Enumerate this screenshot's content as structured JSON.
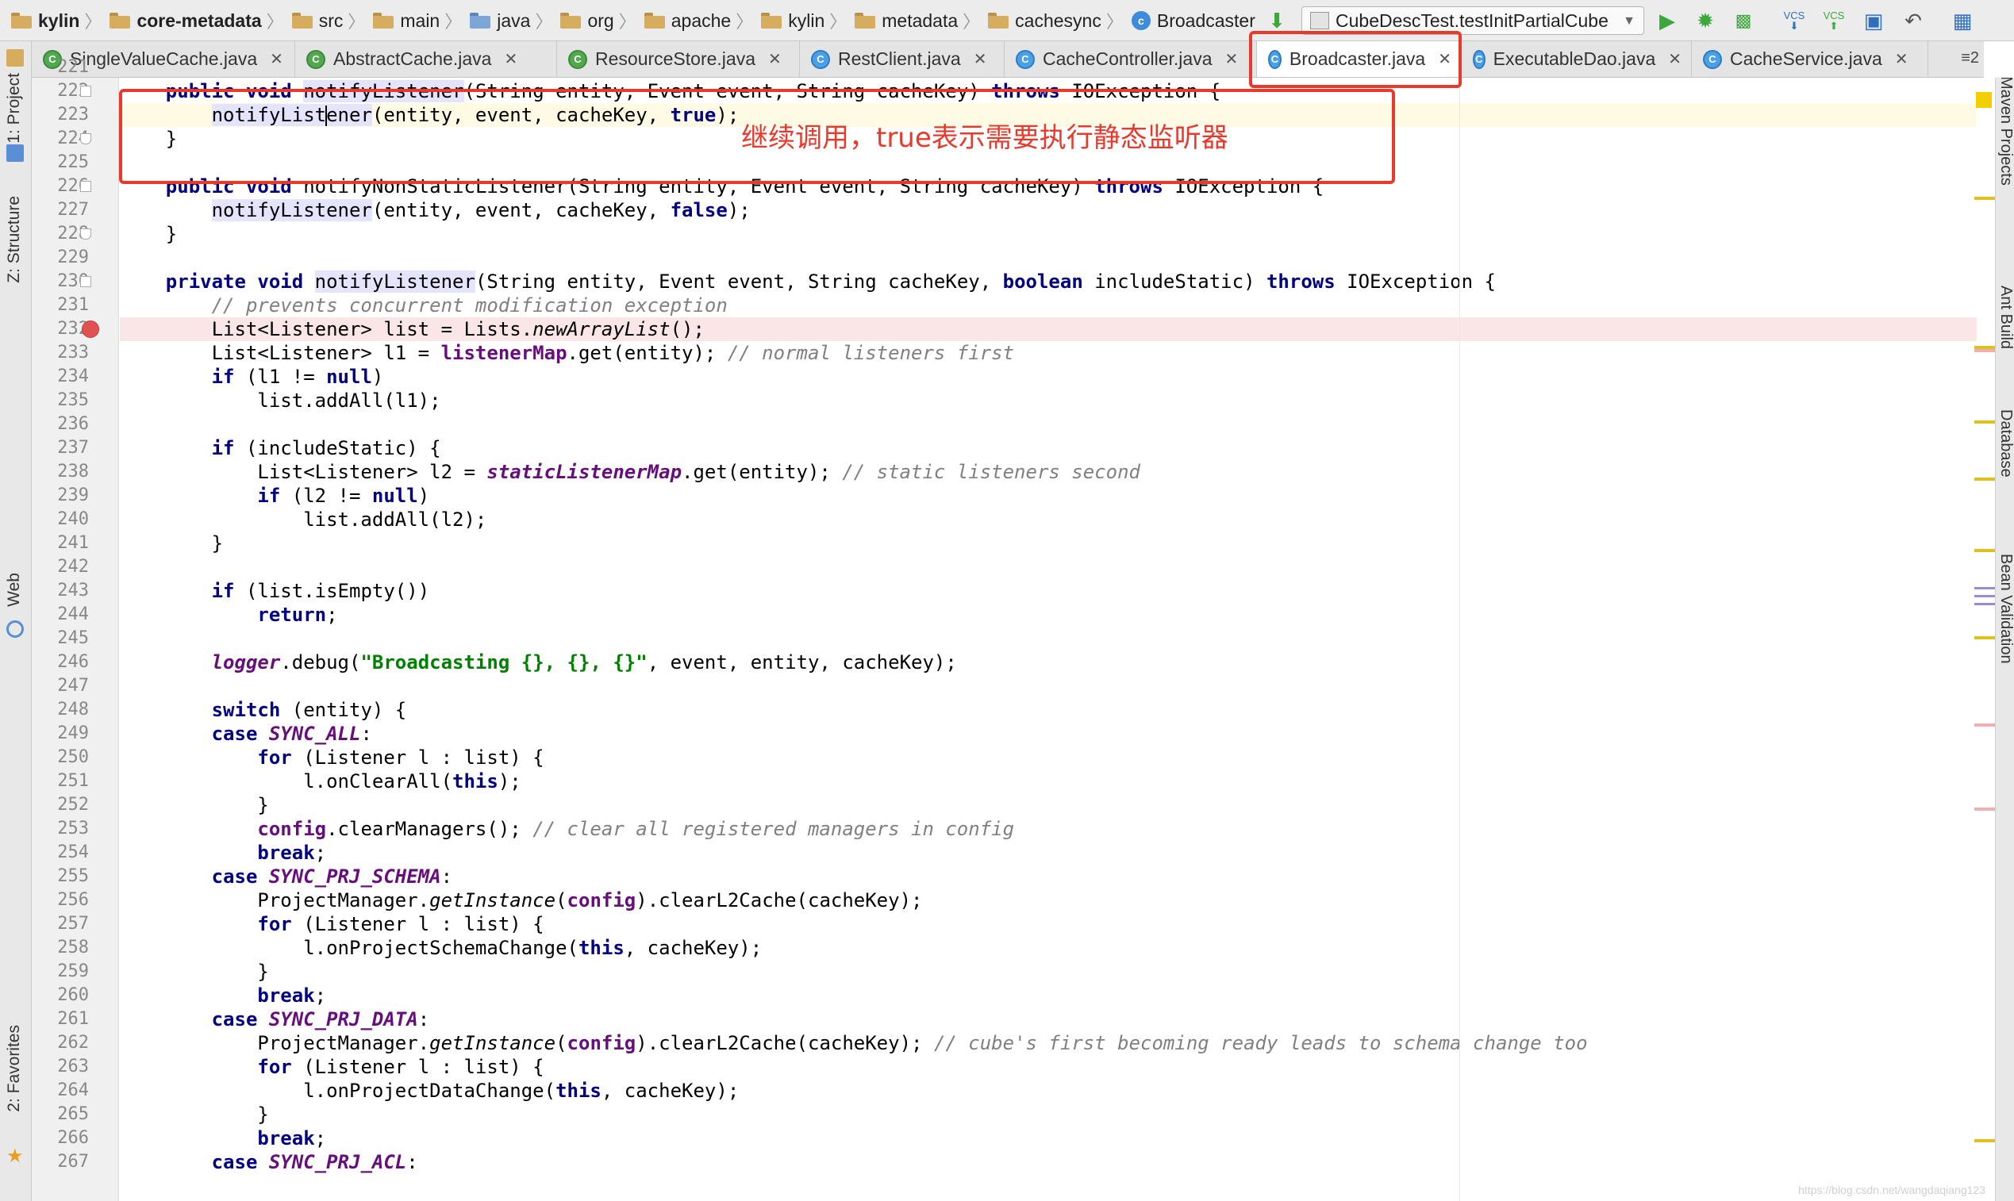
{
  "breadcrumbs": [
    {
      "label": "kylin",
      "kind": "root"
    },
    {
      "label": "core-metadata",
      "kind": "module"
    },
    {
      "label": "src",
      "kind": "folder"
    },
    {
      "label": "main",
      "kind": "folder"
    },
    {
      "label": "java",
      "kind": "src"
    },
    {
      "label": "org",
      "kind": "folder"
    },
    {
      "label": "apache",
      "kind": "folder"
    },
    {
      "label": "kylin",
      "kind": "folder"
    },
    {
      "label": "metadata",
      "kind": "folder"
    },
    {
      "label": "cachesync",
      "kind": "folder"
    },
    {
      "label": "Broadcaster",
      "kind": "class"
    }
  ],
  "run_config": "CubeDescTest.testInitPartialCube",
  "toolbar": {
    "vcs1": "VCS",
    "vcs2": "VCS",
    "colors": {
      "run": "#3aa83a",
      "debug": "#3aa83a"
    }
  },
  "tabs": [
    {
      "label": "SingleValueCache.java",
      "icon": "C",
      "green": true,
      "active": false
    },
    {
      "label": "AbstractCache.java",
      "icon": "C",
      "green": true,
      "active": false
    },
    {
      "label": "ResourceStore.java",
      "icon": "C",
      "green": true,
      "active": false
    },
    {
      "label": "RestClient.java",
      "icon": "C",
      "green": false,
      "active": false
    },
    {
      "label": "CacheController.java",
      "icon": "C",
      "green": false,
      "active": false
    },
    {
      "label": "Broadcaster.java",
      "icon": "C",
      "green": false,
      "active": true
    },
    {
      "label": "ExecutableDao.java",
      "icon": "C",
      "green": false,
      "active": false
    },
    {
      "label": "CacheService.java",
      "icon": "C",
      "green": false,
      "active": false
    }
  ],
  "tabs_overflow": "≡2",
  "left_tools": {
    "project": "1: Project",
    "structure": "Z: Structure",
    "web": "Web",
    "favorites": "2: Favorites"
  },
  "right_tools": {
    "maven": "Maven Projects",
    "ant": "Ant Build",
    "database": "Database",
    "bean": "Bean Validation"
  },
  "code_lines": [
    {
      "n": "221",
      "t": ""
    },
    {
      "n": "222",
      "t": "    public void notifyListener(String entity, Event event, String cacheKey) throws IOException {"
    },
    {
      "n": "223",
      "t": "        notifyListener(entity, event, cacheKey, true);"
    },
    {
      "n": "224",
      "t": "    }"
    },
    {
      "n": "225",
      "t": ""
    },
    {
      "n": "226",
      "t": "    public void notifyNonStaticListener(String entity, Event event, String cacheKey) throws IOException {"
    },
    {
      "n": "227",
      "t": "        notifyListener(entity, event, cacheKey, false);"
    },
    {
      "n": "228",
      "t": "    }"
    },
    {
      "n": "229",
      "t": ""
    },
    {
      "n": "230",
      "t": "    private void notifyListener(String entity, Event event, String cacheKey, boolean includeStatic) throws IOException {"
    },
    {
      "n": "231",
      "t": "        // prevents concurrent modification exception"
    },
    {
      "n": "232",
      "t": "        List<Listener> list = Lists.newArrayList();"
    },
    {
      "n": "233",
      "t": "        List<Listener> l1 = listenerMap.get(entity); // normal listeners first"
    },
    {
      "n": "234",
      "t": "        if (l1 != null)"
    },
    {
      "n": "235",
      "t": "            list.addAll(l1);"
    },
    {
      "n": "236",
      "t": ""
    },
    {
      "n": "237",
      "t": "        if (includeStatic) {"
    },
    {
      "n": "238",
      "t": "            List<Listener> l2 = staticListenerMap.get(entity); // static listeners second"
    },
    {
      "n": "239",
      "t": "            if (l2 != null)"
    },
    {
      "n": "240",
      "t": "                list.addAll(l2);"
    },
    {
      "n": "241",
      "t": "        }"
    },
    {
      "n": "242",
      "t": ""
    },
    {
      "n": "243",
      "t": "        if (list.isEmpty())"
    },
    {
      "n": "244",
      "t": "            return;"
    },
    {
      "n": "245",
      "t": ""
    },
    {
      "n": "246",
      "t": "        logger.debug(\"Broadcasting {}, {}, {}\", event, entity, cacheKey);"
    },
    {
      "n": "247",
      "t": ""
    },
    {
      "n": "248",
      "t": "        switch (entity) {"
    },
    {
      "n": "249",
      "t": "        case SYNC_ALL:"
    },
    {
      "n": "250",
      "t": "            for (Listener l : list) {"
    },
    {
      "n": "251",
      "t": "                l.onClearAll(this);"
    },
    {
      "n": "252",
      "t": "            }"
    },
    {
      "n": "253",
      "t": "            config.clearManagers(); // clear all registered managers in config"
    },
    {
      "n": "254",
      "t": "            break;"
    },
    {
      "n": "255",
      "t": "        case SYNC_PRJ_SCHEMA:"
    },
    {
      "n": "256",
      "t": "            ProjectManager.getInstance(config).clearL2Cache(cacheKey);"
    },
    {
      "n": "257",
      "t": "            for (Listener l : list) {"
    },
    {
      "n": "258",
      "t": "                l.onProjectSchemaChange(this, cacheKey);"
    },
    {
      "n": "259",
      "t": "            }"
    },
    {
      "n": "260",
      "t": "            break;"
    },
    {
      "n": "261",
      "t": "        case SYNC_PRJ_DATA:"
    },
    {
      "n": "262",
      "t": "            ProjectManager.getInstance(config).clearL2Cache(cacheKey); // cube's first becoming ready leads to schema change too"
    },
    {
      "n": "263",
      "t": "            for (Listener l : list) {"
    },
    {
      "n": "264",
      "t": "                l.onProjectDataChange(this, cacheKey);"
    },
    {
      "n": "265",
      "t": "            }"
    },
    {
      "n": "266",
      "t": "            break;"
    },
    {
      "n": "267",
      "t": "        case SYNC_PRJ_ACL:"
    }
  ],
  "annotation": "继续调用，true表示需要执行静态监听器",
  "watermark": "https://blog.csdn.net/wangdaqiang123",
  "colors": {
    "annotation": "#e8392b",
    "keyword": "#000080",
    "string": "#008000",
    "comment": "#808080",
    "field": "#660e7a"
  }
}
